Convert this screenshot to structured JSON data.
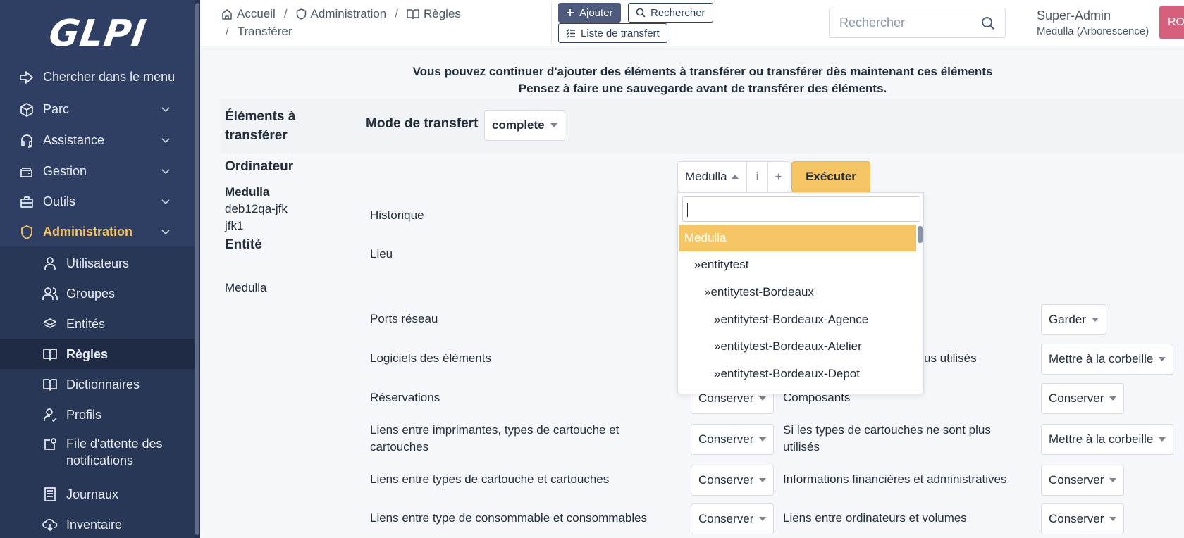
{
  "sidebar": {
    "logo": "GLPI",
    "items": [
      {
        "label": "Chercher dans le menu"
      },
      {
        "label": "Parc"
      },
      {
        "label": "Assistance"
      },
      {
        "label": "Gestion"
      },
      {
        "label": "Outils"
      },
      {
        "label": "Administration"
      }
    ],
    "subitems": [
      {
        "label": "Utilisateurs"
      },
      {
        "label": "Groupes"
      },
      {
        "label": "Entités"
      },
      {
        "label": "Règles"
      },
      {
        "label": "Dictionnaires"
      },
      {
        "label": "Profils"
      },
      {
        "label": "File d'attente des notifications"
      },
      {
        "label": "Journaux"
      },
      {
        "label": "Inventaire"
      }
    ]
  },
  "header": {
    "breadcrumb": [
      "Accueil",
      "Administration",
      "Règles",
      "Transférer"
    ],
    "add_label": "Ajouter",
    "search_label": "Rechercher",
    "transfer_list_label": "Liste de transfert",
    "search_placeholder": "Rechercher",
    "user_name": "Super-Admin",
    "user_entity": "Medulla (Arborescence)",
    "avatar_initials": "RO"
  },
  "main": {
    "notice_line1": "Vous pouvez continuer d'ajouter des éléments à transférer ou transférer dès maintenant ces éléments",
    "notice_line2": "Pensez à faire une sauvegarde avant de transférer des éléments.",
    "elements_title": "Éléments à transférer",
    "mode_label": "Mode de transfert",
    "mode_value": "complete",
    "computer_title": "Ordinateur",
    "computer_name": "Medulla",
    "computer_id_1": "deb12qa-jfk",
    "computer_id_2": "jfk1",
    "entity_title": "Entité",
    "entity_value": "Medulla",
    "entity_select": "Medulla",
    "info_glyph": "i",
    "plus_glyph": "+",
    "execute_label": "Exécuter",
    "rows": [
      {
        "label": "Historique"
      },
      {
        "label": "Lieu"
      },
      {
        "label": "Ports réseau",
        "right_value": "Garder"
      },
      {
        "label": "Logiciels des éléments",
        "mid_partial": "us utilisés",
        "right_value": "Mettre à la corbeille"
      },
      {
        "label": "Réservations",
        "mid_value": "Conserver",
        "mid_label": "Composants",
        "right_value": "Conserver"
      },
      {
        "label": "Liens entre imprimantes, types de cartouche et cartouches",
        "mid_value": "Conserver",
        "mid_label": "Si les types de cartouches ne sont plus utilisés",
        "right_value": "Mettre à la corbeille"
      },
      {
        "label": "Liens entre types de cartouche et cartouches",
        "mid_value": "Conserver",
        "mid_label": "Informations financières et administratives",
        "right_value": "Conserver"
      },
      {
        "label": "Liens entre type de consommable et consommables",
        "mid_value": "Conserver",
        "mid_label": "Liens entre ordinateurs et volumes",
        "right_value": "Conserver"
      }
    ]
  },
  "dropdown": {
    "options": [
      {
        "label": "Medulla"
      },
      {
        "label": "»entitytest"
      },
      {
        "label": "»entitytest-Bordeaux"
      },
      {
        "label": "»entitytest-Bordeaux-Agence"
      },
      {
        "label": "»entitytest-Bordeaux-Atelier"
      },
      {
        "label": "»entitytest-Bordeaux-Depot"
      }
    ]
  },
  "colors": {
    "sidebar": "#2f3f64",
    "accent": "#f5c563",
    "avatar": "#d6607b"
  }
}
